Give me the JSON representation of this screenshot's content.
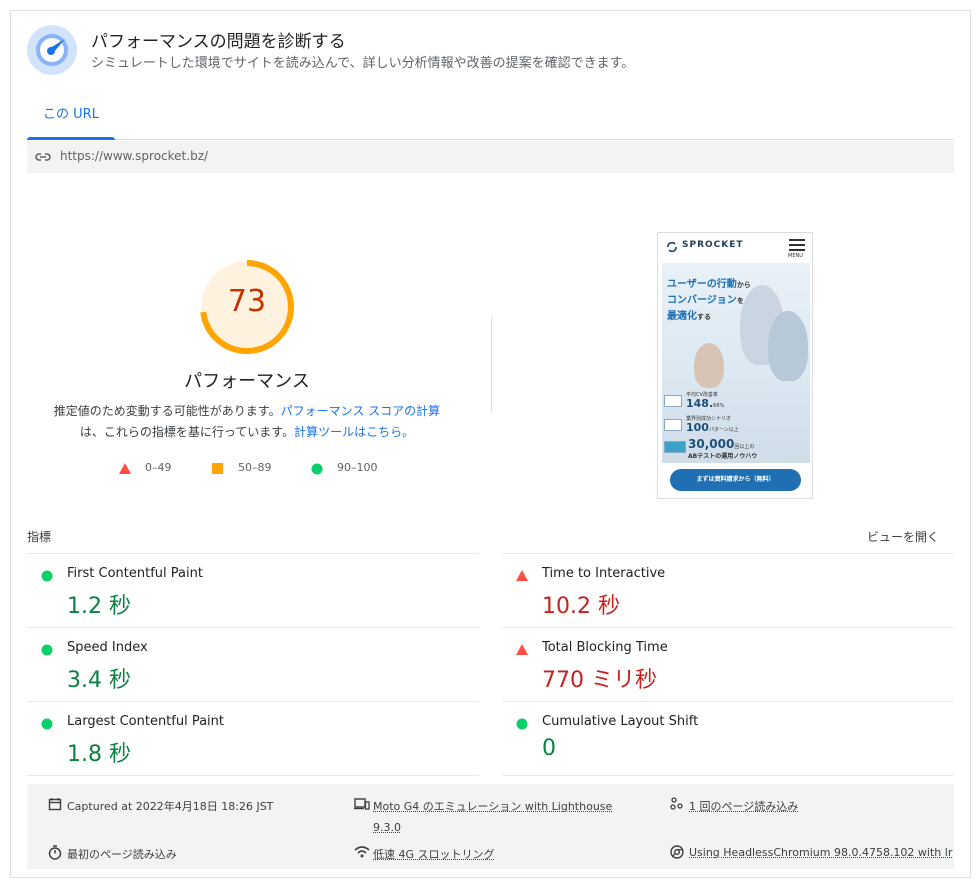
{
  "header": {
    "title": "パフォーマンスの問題を診断する",
    "subtitle": "シミュレートした環境でサイトを読み込んで、詳しい分析情報や改善の提案を確認できます。"
  },
  "tabs": [
    {
      "label": "この URL",
      "active": true
    }
  ],
  "url_bar": {
    "url": "https://www.sprocket.bz/"
  },
  "score": {
    "value": 73,
    "label": "パフォーマンス",
    "description_prefix": "推定値のため変動する可能性があります。",
    "description_link1": "パフォーマンス スコアの計算",
    "description_middle": "は、これらの指標を基に行っています。",
    "description_link2": "計算ツールはこちら。"
  },
  "legend": [
    {
      "shape": "triangle",
      "color": "#ff4e42",
      "label": "0–49"
    },
    {
      "shape": "square",
      "color": "#ffa400",
      "label": "50–89"
    },
    {
      "shape": "circle",
      "color": "#0cce6b",
      "label": "90–100"
    }
  ],
  "thumbnail": {
    "brand": "SPROCKET",
    "menu": "MENU",
    "headline_1a": "ユーザーの行動",
    "headline_1b": "から",
    "headline_2a": "コンバージョン",
    "headline_2b": "を",
    "headline_3a": "最適化",
    "headline_3b": "する",
    "stat1_label": "平均CV改善率",
    "stat1_value": "148.",
    "stat1_suffix": "66%",
    "stat2_label": "業界別成功シナリオ",
    "stat2_value": "100",
    "stat2_suffix": "パターン以上",
    "stat3_value": "30,000",
    "stat3_suffix": "回以上の",
    "stat3_label": "ABテストの運用ノウハウ",
    "cta": "まずは資料請求から（無料）"
  },
  "metrics_section": {
    "title": "指標",
    "toggle": "ビューを開く"
  },
  "metrics": {
    "left": [
      {
        "name": "First Contentful Paint",
        "value": "1.2 秒",
        "status": "good"
      },
      {
        "name": "Speed Index",
        "value": "3.4 秒",
        "status": "good"
      },
      {
        "name": "Largest Contentful Paint",
        "value": "1.8 秒",
        "status": "good"
      }
    ],
    "right": [
      {
        "name": "Time to Interactive",
        "value": "10.2 秒",
        "status": "bad"
      },
      {
        "name": "Total Blocking Time",
        "value": "770 ミリ秒",
        "status": "bad"
      },
      {
        "name": "Cumulative Layout Shift",
        "value": "0",
        "status": "good"
      }
    ]
  },
  "footer": {
    "captured": "Captured at 2022年4月18日 18:26 JST",
    "device": "Moto G4 のエミュレーション with Lighthouse",
    "device_version": "9.3.0",
    "page_loads": "1 回のページ読み込み",
    "initial_load": "最初のページ読み込み",
    "throttling": "低速 4G スロットリング",
    "browser": "Using HeadlessChromium 98.0.4758.102 with lr"
  },
  "colors": {
    "good": "#0b8043",
    "bad": "#c5221f",
    "average": "#ffa400",
    "accent": "#1a73e8"
  }
}
